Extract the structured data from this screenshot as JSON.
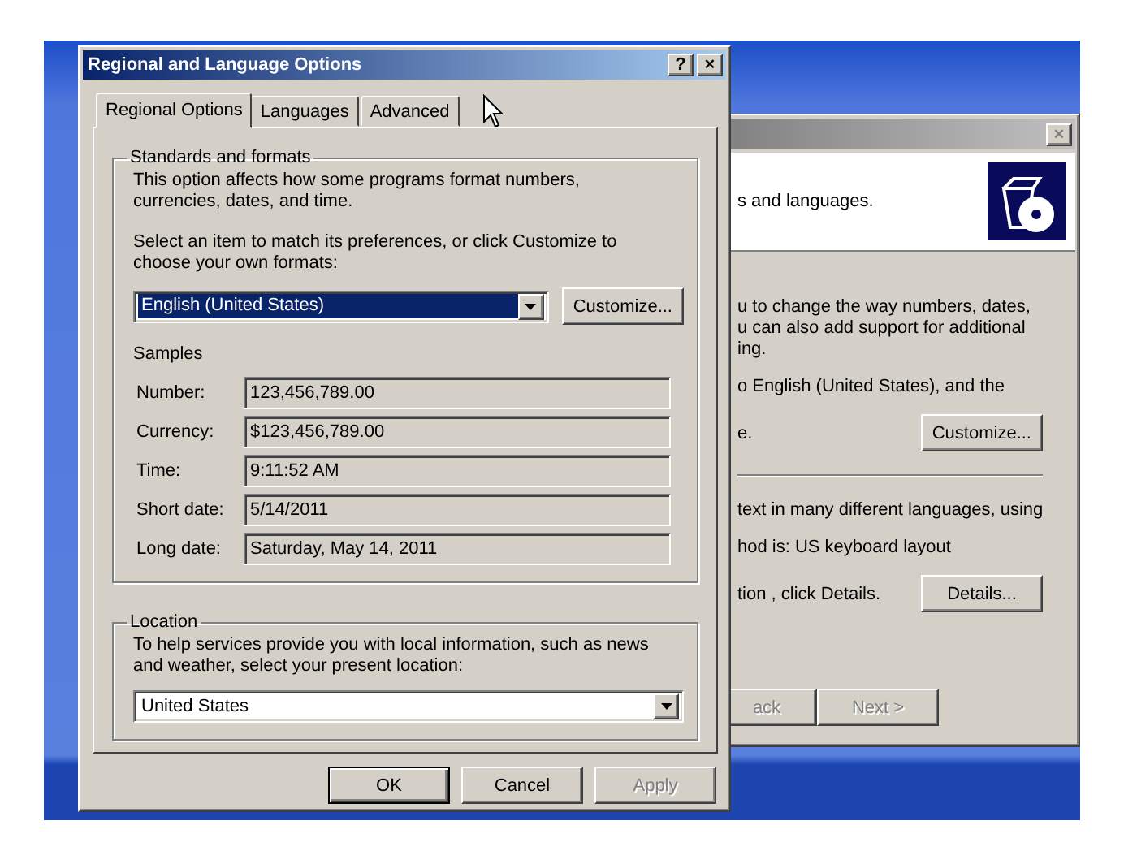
{
  "back_window": {
    "close_button": "×",
    "header_text": "s and languages.",
    "items": [
      {
        "kind": "paragraph",
        "lines": [
          "u to change the way numbers, dates,",
          "u can also add support for additional",
          "ing."
        ]
      },
      {
        "kind": "paragraph",
        "lines": [
          "o English (United States), and the"
        ]
      },
      {
        "kind": "action",
        "text": "e.",
        "button": "Customize..."
      },
      {
        "kind": "rule"
      },
      {
        "kind": "paragraph",
        "lines": [
          "text in many different languages, using"
        ]
      },
      {
        "kind": "paragraph",
        "lines": [
          "hod is: US keyboard layout"
        ]
      },
      {
        "kind": "action",
        "text": "tion , click Details.",
        "button": "Details..."
      }
    ],
    "footer_buttons": [
      {
        "label": "ack",
        "disabled": true
      },
      {
        "label": "Next >",
        "disabled": true
      }
    ]
  },
  "dialog": {
    "title": "Regional and Language Options",
    "help_button": "?",
    "close_button": "×",
    "tabs": [
      {
        "label": "Regional Options",
        "selected": true
      },
      {
        "label": "Languages",
        "selected": false
      },
      {
        "label": "Advanced",
        "selected": false
      }
    ],
    "standards": {
      "legend": "Standards and formats",
      "description": "This option affects how some programs format numbers, currencies, dates, and time.",
      "instruction": "Select an item to match its preferences, or click Customize to choose your own formats:",
      "format_combo": {
        "value": "English (United States)",
        "highlighted": true
      },
      "customize_button": "Customize...",
      "samples_title": "Samples",
      "samples": [
        {
          "label": "Number:",
          "value": "123,456,789.00"
        },
        {
          "label": "Currency:",
          "value": "$123,456,789.00"
        },
        {
          "label": "Time:",
          "value": "9:11:52 AM"
        },
        {
          "label": "Short date:",
          "value": "5/14/2011"
        },
        {
          "label": "Long date:",
          "value": "Saturday, May 14, 2011"
        }
      ]
    },
    "location": {
      "legend": "Location",
      "description": "To help services provide you with local information, such as news and weather, select your present location:",
      "combo": {
        "value": "United States",
        "highlighted": false
      }
    },
    "buttons": [
      {
        "label": "OK",
        "disabled": false,
        "default": true
      },
      {
        "label": "Cancel",
        "disabled": false,
        "default": false
      },
      {
        "label": "Apply",
        "disabled": true,
        "default": false
      }
    ]
  }
}
